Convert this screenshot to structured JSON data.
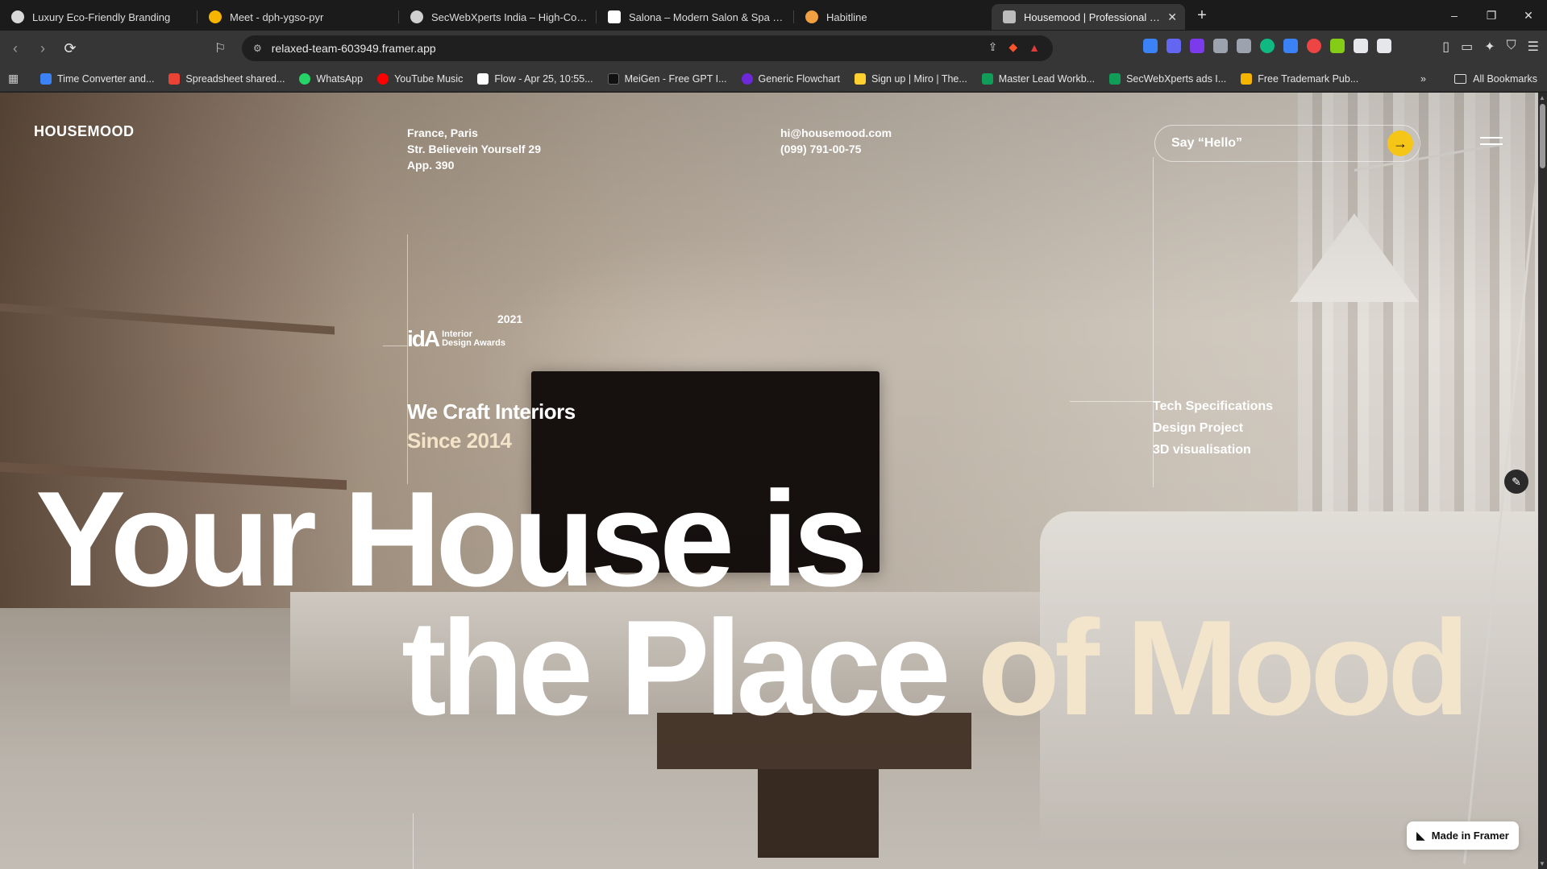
{
  "browser": {
    "tabs": [
      {
        "title": "Luxury Eco-Friendly Branding",
        "fav_color": "#d9d9d9"
      },
      {
        "title": "Meet - dph-ygso-pyr",
        "fav_color": "#f4b400"
      },
      {
        "title": "SecWebXperts India – High-Converting",
        "fav_color": "#cfcfcf"
      },
      {
        "title": "Salona – Modern Salon & Spa Template",
        "fav_color": "#ffffff"
      },
      {
        "title": "Habitline",
        "fav_color": "#f0a040"
      },
      {
        "title": "Housemood | Professional Interior",
        "fav_color": "#bdbdbd"
      }
    ],
    "new_tab": "+",
    "window": {
      "minimize": "–",
      "restore": "❐",
      "close": "✕"
    },
    "url": "relaxed-team-603949.framer.app",
    "bookmarks": [
      {
        "label": "Time Converter and...",
        "color": "#3b82f6"
      },
      {
        "label": "Spreadsheet shared...",
        "color": "#ea4335"
      },
      {
        "label": "WhatsApp",
        "color": "#25d366"
      },
      {
        "label": "YouTube Music",
        "color": "#ff0000"
      },
      {
        "label": "Flow - Apr 25, 10:55...",
        "color": "#ffffff"
      },
      {
        "label": "MeiGen - Free GPT I...",
        "color": "#111111"
      },
      {
        "label": "Generic Flowchart",
        "color": "#6d28d9"
      },
      {
        "label": "Sign up | Miro | The...",
        "color": "#ffd02f"
      },
      {
        "label": "Master Lead Workb...",
        "color": "#0f9d58"
      },
      {
        "label": "SecWebXperts ads I...",
        "color": "#0f9d58"
      },
      {
        "label": "Free Trademark Pub...",
        "color": "#f4b400"
      }
    ],
    "bookmarks_more": "»",
    "all_bookmarks": "All Bookmarks",
    "extension_colors": [
      "#3b82f6",
      "#6366f1",
      "#7c3aed",
      "#9ca3af",
      "#9ca3af",
      "#10b981",
      "#3b82f6",
      "#ef4444",
      "#84cc16",
      "#e5e7eb",
      "#e5e7eb"
    ]
  },
  "site": {
    "logo": "HOUSEMOOD",
    "address": [
      "France, Paris",
      "Str. Believein Yourself 29",
      "App. 390"
    ],
    "contact": [
      "hi@housemood.com",
      "(099) 791-00-75"
    ],
    "hello_label": "Say “Hello”",
    "award": {
      "year": "2021",
      "mark": "idA",
      "line1": "Interior",
      "line2": "Design Awards"
    },
    "craft": {
      "line1": "We Craft Interiors",
      "line2": "Since 2014"
    },
    "services": [
      "Tech Specifications",
      "Design Project",
      "3D visualisation"
    ],
    "hero": {
      "line1": "Your House is",
      "line2_a": "the Place ",
      "line2_b": "of Mood"
    },
    "framer_badge": "Made in Framer"
  }
}
